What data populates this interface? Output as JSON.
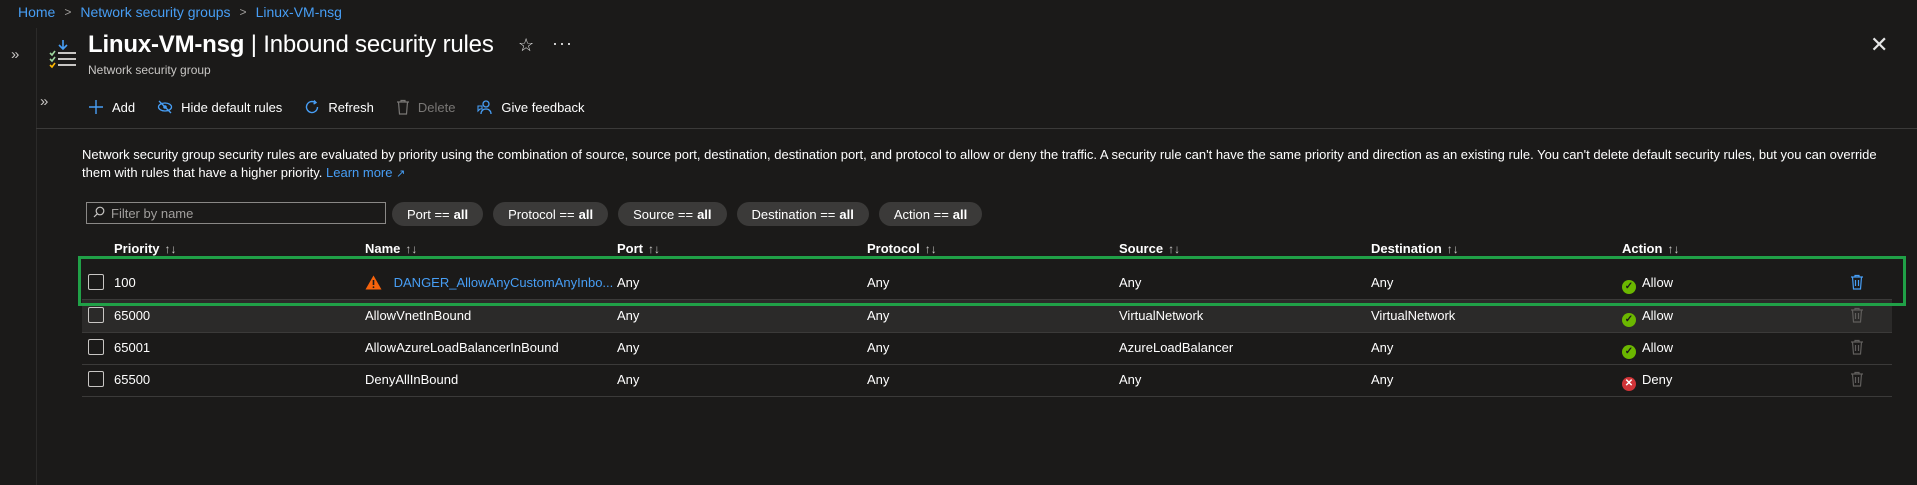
{
  "breadcrumb": [
    "Home",
    "Network security groups",
    "Linux-VM-nsg"
  ],
  "header": {
    "title": "Linux-VM-nsg",
    "title_separator": "|",
    "title_suffix": "Inbound security rules",
    "subtitle": "Network security group"
  },
  "toolbar": {
    "add": "Add",
    "hide_default": "Hide default rules",
    "refresh": "Refresh",
    "delete": "Delete",
    "feedback": "Give feedback"
  },
  "description": {
    "text": "Network security group security rules are evaluated by priority using the combination of source, source port, destination, destination port, and protocol to allow or deny the traffic. A security rule can't have the same priority and direction as an existing rule. You can't delete default security rules, but you can override them with rules that have a higher priority.",
    "learn_more": "Learn more"
  },
  "filter": {
    "placeholder": "Filter by name",
    "pills": [
      {
        "label": "Port ==",
        "value": "all"
      },
      {
        "label": "Protocol ==",
        "value": "all"
      },
      {
        "label": "Source ==",
        "value": "all"
      },
      {
        "label": "Destination ==",
        "value": "all"
      },
      {
        "label": "Action ==",
        "value": "all"
      }
    ]
  },
  "table": {
    "columns": [
      "Priority",
      "Name",
      "Port",
      "Protocol",
      "Source",
      "Destination",
      "Action"
    ],
    "sort_glyph": "↑↓",
    "rows": [
      {
        "priority": "100",
        "name": "DANGER_AllowAnyCustomAnyInbo...",
        "port": "Any",
        "protocol": "Any",
        "source": "Any",
        "destination": "Any",
        "action": "Allow"
      },
      {
        "priority": "65000",
        "name": "AllowVnetInBound",
        "port": "Any",
        "protocol": "Any",
        "source": "VirtualNetwork",
        "destination": "VirtualNetwork",
        "action": "Allow"
      },
      {
        "priority": "65001",
        "name": "AllowAzureLoadBalancerInBound",
        "port": "Any",
        "protocol": "Any",
        "source": "AzureLoadBalancer",
        "destination": "Any",
        "action": "Allow"
      },
      {
        "priority": "65500",
        "name": "DenyAllInBound",
        "port": "Any",
        "protocol": "Any",
        "source": "Any",
        "destination": "Any",
        "action": "Deny"
      }
    ]
  },
  "colors": {
    "background": "#1b1a19",
    "link": "#479ef5",
    "allow": "#6bb700",
    "deny": "#d13438",
    "highlight": "#20a047",
    "warning": "#f7630c"
  },
  "icons": {
    "star": "star-icon",
    "more": "ellipsis-icon",
    "close": "close-icon"
  }
}
